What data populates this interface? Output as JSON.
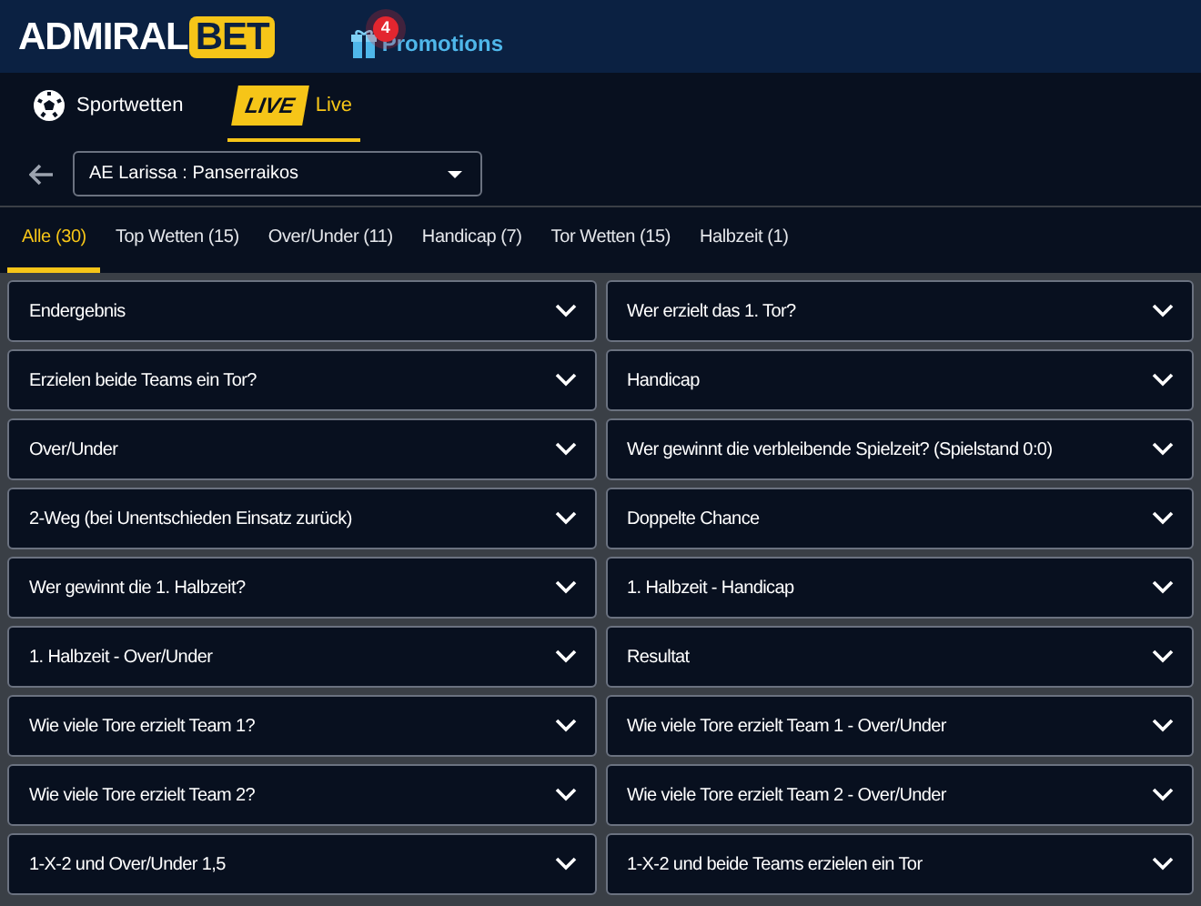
{
  "header": {
    "logo": {
      "part_1": "ADMIRAL",
      "part_2": "BET"
    },
    "promotions": {
      "label": "Promotions",
      "badge": "4"
    }
  },
  "nav": [
    {
      "kind": "ball",
      "label": "Sportwetten",
      "selected": false
    },
    {
      "kind": "live",
      "tag": "LIVE",
      "label": "Live",
      "selected": true
    }
  ],
  "match_select": {
    "value": "AE Larissa : Panserraikos"
  },
  "tabs": [
    {
      "label": "Alle (30)",
      "selected": true
    },
    {
      "label": "Top Wetten (15)",
      "selected": false
    },
    {
      "label": "Over/Under (11)",
      "selected": false
    },
    {
      "label": "Handicap (7)",
      "selected": false
    },
    {
      "label": "Tor Wetten (15)",
      "selected": false
    },
    {
      "label": "Halbzeit (1)",
      "selected": false
    }
  ],
  "markets": [
    {
      "label": "Endergebnis",
      "expanded": false
    },
    {
      "label": "Wer erzielt das 1. Tor?",
      "expanded": false
    },
    {
      "label": "Erzielen beide Teams ein Tor?",
      "expanded": false
    },
    {
      "label": "Handicap",
      "expanded": false
    },
    {
      "label": "Over/Under",
      "expanded": false
    },
    {
      "label": "Wer gewinnt die verbleibende Spielzeit? (Spielstand 0:0)",
      "expanded": false
    },
    {
      "label": "2-Weg (bei Unentschieden Einsatz zurück)",
      "expanded": false
    },
    {
      "label": "Doppelte Chance",
      "expanded": false
    },
    {
      "label": "Wer gewinnt die 1. Halbzeit?",
      "expanded": false
    },
    {
      "label": "1. Halbzeit - Handicap",
      "expanded": false
    },
    {
      "label": "1. Halbzeit - Over/Under",
      "expanded": false
    },
    {
      "label": "Resultat",
      "expanded": false
    },
    {
      "label": "Wie viele Tore erzielt Team 1?",
      "expanded": false
    },
    {
      "label": "Wie viele Tore erzielt Team 1 - Over/Under",
      "expanded": false
    },
    {
      "label": "Wie viele Tore erzielt Team 2?",
      "expanded": false
    },
    {
      "label": "Wie viele Tore erzielt Team 2 - Over/Under",
      "expanded": false
    },
    {
      "label": "1-X-2 und Over/Under 1,5",
      "expanded": false
    },
    {
      "label": "1-X-2 und beide Teams erzielen ein Tor",
      "expanded": false
    }
  ]
}
